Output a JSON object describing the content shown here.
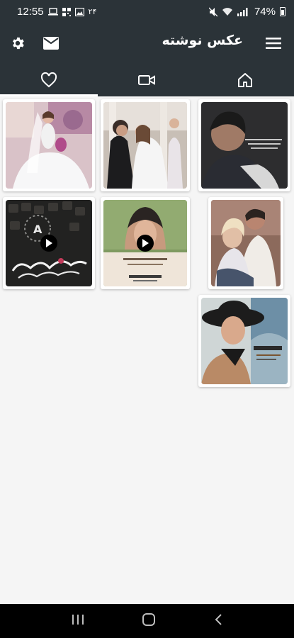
{
  "status_bar": {
    "time": "12:55",
    "notif_text": "۲۴",
    "battery": "74%"
  },
  "app_bar": {
    "title": "عکس نوشته"
  },
  "tabs": [
    {
      "name": "favorites",
      "icon": "heart-icon",
      "active": true
    },
    {
      "name": "videos",
      "icon": "video-icon",
      "active": false
    },
    {
      "name": "home",
      "icon": "home-icon",
      "active": false
    }
  ],
  "colors": {
    "toolbar": "#2b3338",
    "background": "#f5f5f5",
    "nav_bar": "#000000"
  },
  "gallery": {
    "items": [
      {
        "id": 1,
        "kind": "image"
      },
      {
        "id": 2,
        "kind": "image"
      },
      {
        "id": 3,
        "kind": "image"
      },
      {
        "id": 4,
        "kind": "video"
      },
      {
        "id": 5,
        "kind": "video"
      },
      {
        "id": 6,
        "kind": "image"
      },
      {
        "id": 7,
        "kind": "image"
      }
    ]
  }
}
